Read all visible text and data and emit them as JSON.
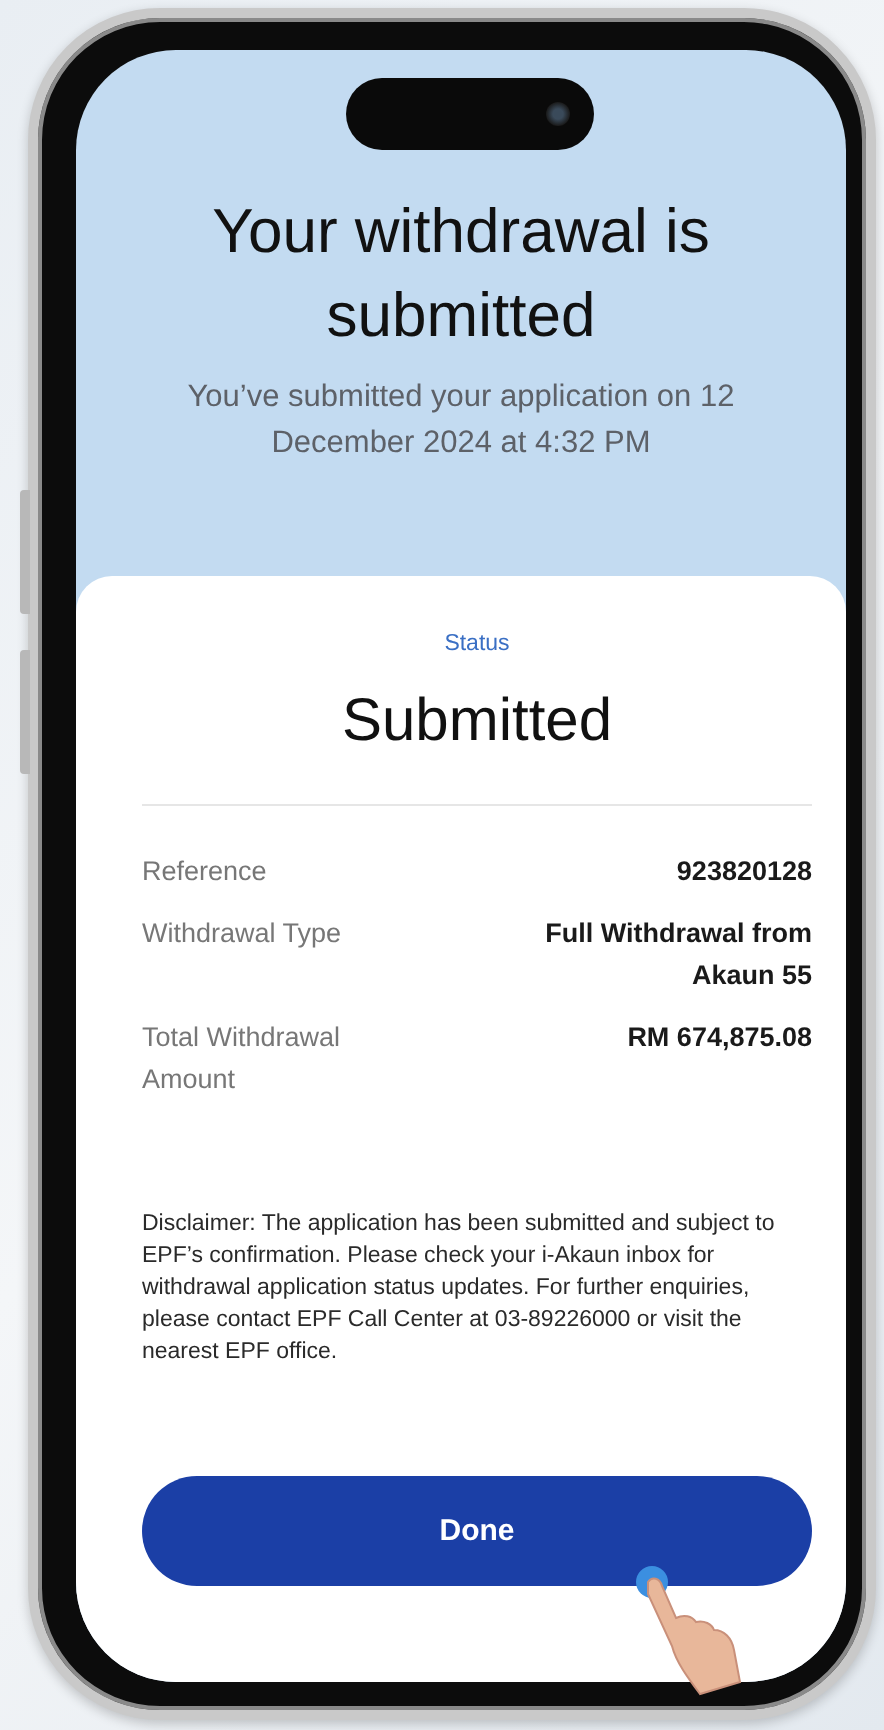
{
  "title": "Your withdrawal is submitted",
  "subtitle": "You’ve submitted your application on 12 December 2024 at 4:32 PM",
  "status": {
    "label": "Status",
    "value": "Submitted"
  },
  "details": [
    {
      "label": "Reference",
      "value": "923820128"
    },
    {
      "label": "Withdrawal Type",
      "value": "Full Withdrawal from Akaun 55"
    },
    {
      "label": "Total Withdrawal Amount",
      "value": "RM 674,875.08"
    }
  ],
  "disclaimer": "Disclaimer: The application has been submitted and subject to EPF’s confirmation. Please check your i-Akaun inbox for withdrawal application status updates. For further enquiries, please contact EPF Call Center at 03-89226000 or visit the nearest EPF office.",
  "button": {
    "label": "Done"
  }
}
